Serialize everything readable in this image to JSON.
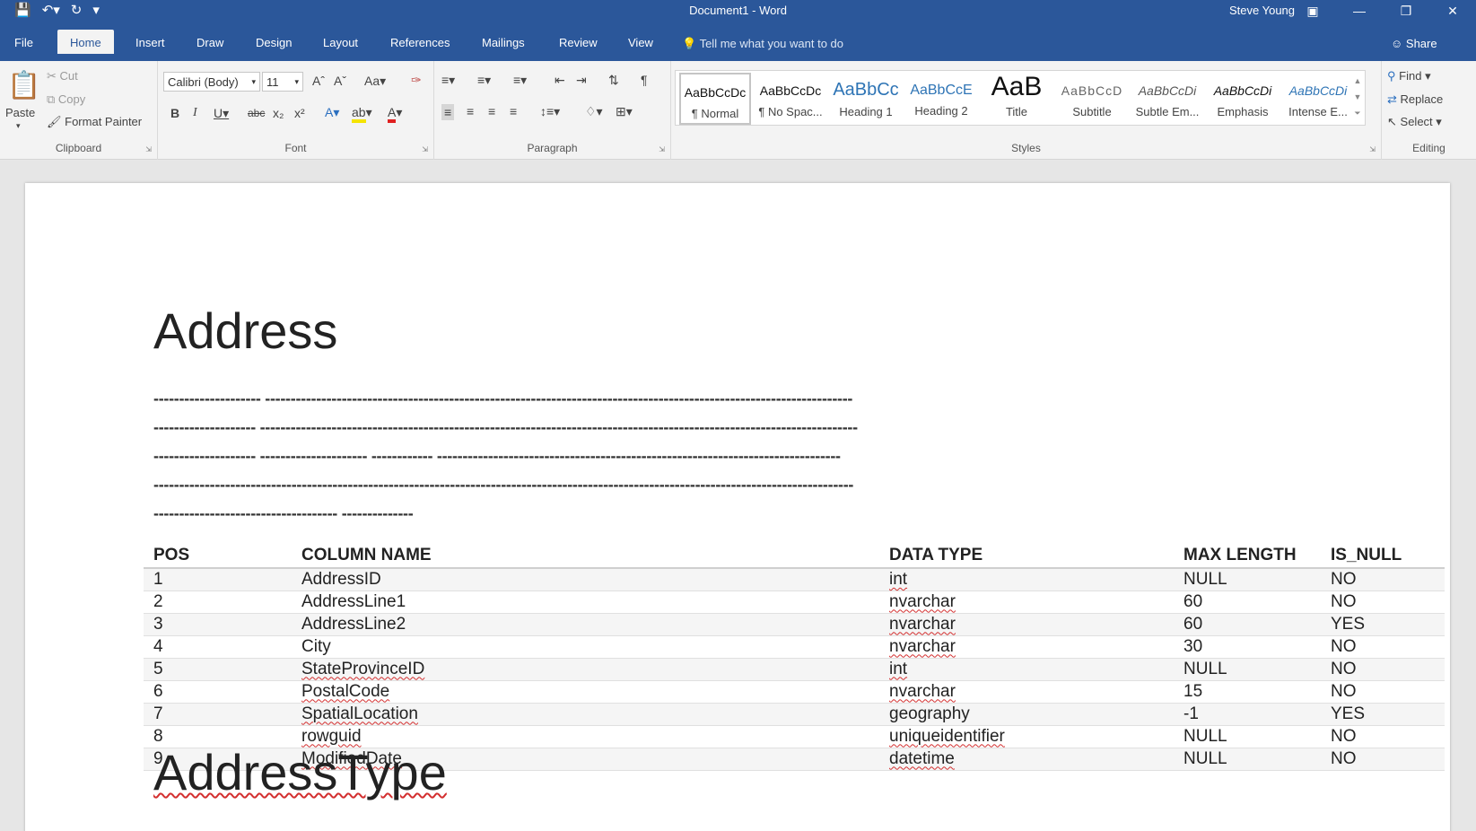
{
  "titlebar": {
    "document_title": "Document1 - Word",
    "user_name": "Steve Young"
  },
  "tabs": [
    {
      "label": "File"
    },
    {
      "label": "Home"
    },
    {
      "label": "Insert"
    },
    {
      "label": "Draw"
    },
    {
      "label": "Design"
    },
    {
      "label": "Layout"
    },
    {
      "label": "References"
    },
    {
      "label": "Mailings"
    },
    {
      "label": "Review"
    },
    {
      "label": "View"
    }
  ],
  "tell_me": "Tell me what you want to do",
  "share_label": "Share",
  "clipboard": {
    "paste": "Paste",
    "cut": "Cut",
    "copy": "Copy",
    "format_painter": "Format Painter",
    "group_label": "Clipboard"
  },
  "font": {
    "font_name": "Calibri (Body)",
    "font_size": "11",
    "group_label": "Font",
    "change_case": "Aa"
  },
  "paragraph": {
    "group_label": "Paragraph"
  },
  "styles": {
    "group_label": "Styles",
    "items": [
      {
        "sample": "AaBbCcDc",
        "name": "¶ Normal"
      },
      {
        "sample": "AaBbCcDc",
        "name": "¶ No Spac..."
      },
      {
        "sample": "AaBbCc",
        "name": "Heading 1"
      },
      {
        "sample": "AaBbCcE",
        "name": "Heading 2"
      },
      {
        "sample": "AaB",
        "name": "Title"
      },
      {
        "sample": "AaBbCcD",
        "name": "Subtitle"
      },
      {
        "sample": "AaBbCcDi",
        "name": "Subtle Em..."
      },
      {
        "sample": "AaBbCcDi",
        "name": "Emphasis"
      },
      {
        "sample": "AaBbCcDi",
        "name": "Intense E..."
      }
    ]
  },
  "editing": {
    "find": "Find",
    "replace": "Replace",
    "select": "Select",
    "group_label": "Editing"
  },
  "document": {
    "heading1": "Address",
    "dash_lines": [
      "--------------------- -------------------------------------------------------------------------------------------------------------------",
      "-------------------- ---------------------------------------------------------------------------------------------------------------------",
      "-------------------- --------------------- ------------ -------------------------------------------------------------------------------",
      "-----------------------------------------------------------------------------------------------------------------------------------------",
      "------------------------------------ --------------"
    ],
    "table": {
      "headers": [
        "POS",
        "COLUMN NAME",
        "DATA TYPE",
        "MAX LENGTH",
        "IS_NULL"
      ],
      "rows": [
        [
          "1",
          "AddressID",
          "int",
          "NULL",
          "NO"
        ],
        [
          "2",
          "AddressLine1",
          "nvarchar",
          "60",
          "NO"
        ],
        [
          "3",
          "AddressLine2",
          "nvarchar",
          "60",
          "YES"
        ],
        [
          "4",
          "City",
          "nvarchar",
          "30",
          "NO"
        ],
        [
          "5",
          "StateProvinceID",
          "int",
          "NULL",
          "NO"
        ],
        [
          "6",
          "PostalCode",
          "nvarchar",
          "15",
          "NO"
        ],
        [
          "7",
          "SpatialLocation",
          "geography",
          "-1",
          "YES"
        ],
        [
          "8",
          "rowguid",
          "uniqueidentifier",
          "NULL",
          "NO"
        ],
        [
          "9",
          "ModifiedDate",
          "datetime",
          "NULL",
          "NO"
        ]
      ]
    },
    "heading2": "AddressType"
  },
  "colors": {
    "word_blue": "#2b579a",
    "ribbon_bg": "#f3f3f3",
    "spell_check": "#d32f2f"
  }
}
